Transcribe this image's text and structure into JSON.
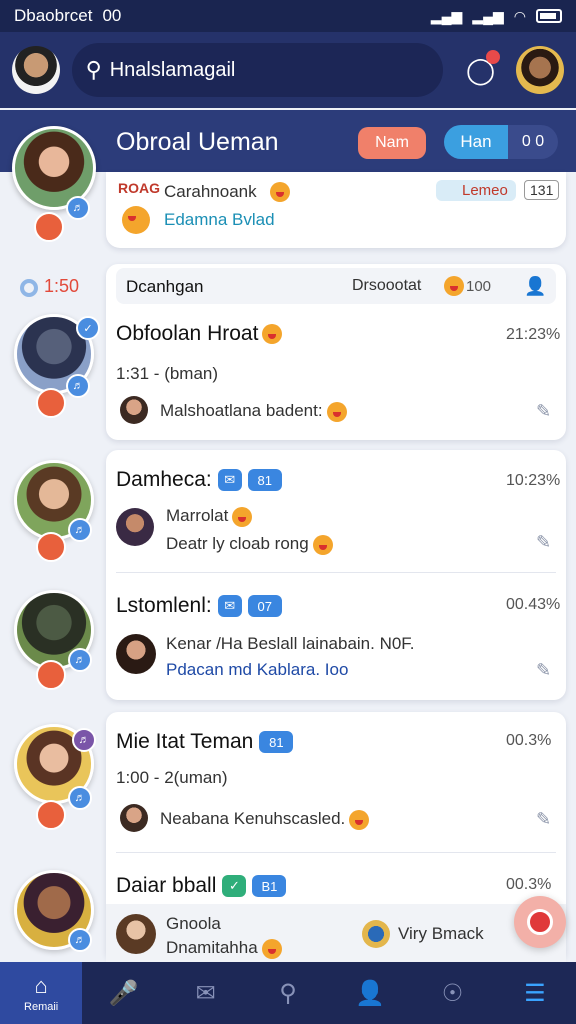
{
  "status_bar": {
    "left_text": "Dbaobrcet",
    "time": "00"
  },
  "app_bar": {
    "search_value": "Hnalslamagail"
  },
  "header": {
    "title": "Obroal Ueman",
    "pill_left": "Nam",
    "pill_right_a": "Han",
    "pill_right_b": "0 0"
  },
  "pinned_card": {
    "line1": "Carahnoank",
    "line2": "Edamna Bvlad",
    "tag": "Lemeo",
    "count": "131"
  },
  "section": {
    "time_label": "1:50",
    "name": "Dcanhgan",
    "meta": "Drsoootat",
    "meta_count": "100"
  },
  "chats": [
    {
      "title": "Obfoolan Hroat",
      "time": "21:23%",
      "sub": "1:31 - (bman)",
      "preview": "Malshoatlana badent:",
      "badge": ""
    },
    {
      "title": "Damheca:",
      "time": "10:23%",
      "badge": "81",
      "sub": "Marrolat",
      "preview": "Deatr ly cloab  rong"
    },
    {
      "title": "Lstomlenl:",
      "time": "00.43%",
      "badge": "07",
      "sub": "Kenar /Ha Beslall lainabain. N0F.",
      "preview": "Pdacan md Kablara. Ioo"
    },
    {
      "title": "Mie Itat Teman",
      "time": "00.3%",
      "badge": "81",
      "sub": "1:00 - 2(uman)",
      "preview": "Neabana Kenuhscasled."
    },
    {
      "title": "Daiar bball",
      "time": "00.3%",
      "badge": "B1",
      "sub": "Gnoola",
      "preview": "Dnamitahha",
      "extra": "Viry  Bmack"
    }
  ],
  "bottom_nav": {
    "active_label": "Remaii"
  },
  "colors": {
    "primary": "#25326a",
    "accent": "#3a86e0",
    "highlight": "#f0806a"
  }
}
